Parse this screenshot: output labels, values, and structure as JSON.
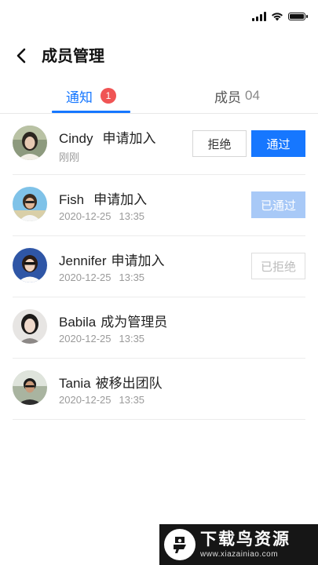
{
  "status_bar": {
    "icons": [
      "signal-icon",
      "wifi-icon",
      "battery-icon"
    ]
  },
  "header": {
    "back_icon": "chevron-left-icon",
    "title": "成员管理"
  },
  "tabs": [
    {
      "label": "通知",
      "badge": "1",
      "active": true
    },
    {
      "label": "成员",
      "count": "04",
      "active": false
    }
  ],
  "colors": {
    "accent": "#1677ff",
    "badge": "#f05454",
    "passed": "#a8c9f7",
    "muted": "#9a9a9a"
  },
  "notifications": [
    {
      "name": "Cindy",
      "action": "申请加入",
      "time": "刚刚",
      "time2": "",
      "buttons": [
        "拒绝",
        "通过"
      ]
    },
    {
      "name": "Fish",
      "action": "申请加入",
      "time": "2020-12-25",
      "time2": "13:35",
      "status": "已通过"
    },
    {
      "name": "Jennifer",
      "action": "申请加入",
      "time": "2020-12-25",
      "time2": "13:35",
      "status": "已拒绝"
    },
    {
      "name": "Babila",
      "action": "成为管理员",
      "time": "2020-12-25",
      "time2": "13:35"
    },
    {
      "name": "Tania",
      "action": "被移出团队",
      "time": "2020-12-25",
      "time2": "13:35"
    }
  ],
  "watermark": {
    "title": "下载鸟资源",
    "url": "www.xiazainiao.com"
  }
}
